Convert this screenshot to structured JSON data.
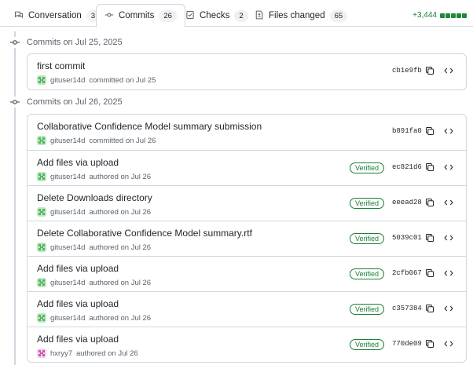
{
  "tabs": [
    {
      "label": "Conversation",
      "count": "3",
      "icon": "conversation-icon"
    },
    {
      "label": "Commits",
      "count": "26",
      "icon": "commit-icon"
    },
    {
      "label": "Checks",
      "count": "2",
      "icon": "checks-icon"
    },
    {
      "label": "Files changed",
      "count": "65",
      "icon": "file-diff-icon"
    }
  ],
  "diffstat": {
    "additions": "+3,444",
    "color": "#1f883d"
  },
  "groups": [
    {
      "date": "Commits on Jul 25, 2025",
      "commits": [
        {
          "title": "first commit",
          "author": "gituser14d",
          "action": "committed on Jul 25",
          "sha": "cb1e9fb",
          "verified": ""
        }
      ]
    },
    {
      "date": "Commits on Jul 26, 2025",
      "commits": [
        {
          "title": "Collaborative Confidence Model summary submission",
          "author": "gituser14d",
          "action": "committed on Jul 26",
          "sha": "b891fa0",
          "verified": ""
        },
        {
          "title": "Add files via upload",
          "author": "gituser14d",
          "action": "authored on Jul 26",
          "sha": "ec821d6",
          "verified": "Verified"
        },
        {
          "title": "Delete Downloads directory",
          "author": "gituser14d",
          "action": "authored on Jul 26",
          "sha": "eeead28",
          "verified": "Verified"
        },
        {
          "title": "Delete Collaborative Confidence Model summary.rtf",
          "author": "gituser14d",
          "action": "authored on Jul 26",
          "sha": "5039c01",
          "verified": "Verified"
        },
        {
          "title": "Add files via upload",
          "author": "gituser14d",
          "action": "authored on Jul 26",
          "sha": "2cfb067",
          "verified": "Verified"
        },
        {
          "title": "Add files via upload",
          "author": "gituser14d",
          "action": "authored on Jul 26",
          "sha": "c357384",
          "verified": "Verified"
        },
        {
          "title": "Add files via upload",
          "author": "hxryy7",
          "action": "authored on Jul 26",
          "sha": "770de09",
          "verified": "Verified"
        }
      ]
    }
  ]
}
